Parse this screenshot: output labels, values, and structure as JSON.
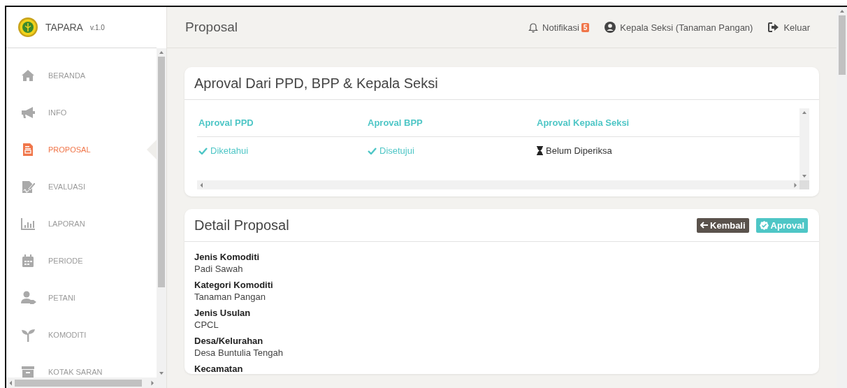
{
  "brand": {
    "name": "TAPARA",
    "version": "v.1.0"
  },
  "sidebar": {
    "items": [
      {
        "label": "BERANDA",
        "selected": false
      },
      {
        "label": "INFO",
        "selected": false
      },
      {
        "label": "PROPOSAL",
        "selected": true
      },
      {
        "label": "EVALUASI",
        "selected": false
      },
      {
        "label": "LAPORAN",
        "selected": false
      },
      {
        "label": "PERIODE",
        "selected": false
      },
      {
        "label": "PETANI",
        "selected": false
      },
      {
        "label": "KOMODITI",
        "selected": false
      },
      {
        "label": "KOTAK SARAN",
        "selected": false
      }
    ]
  },
  "topbar": {
    "title": "Proposal",
    "notification": {
      "label": "Notifikasi",
      "count": "5"
    },
    "user": "Kepala Seksi (Tanaman Pangan)",
    "logout": "Keluar"
  },
  "approval_card": {
    "title": "Aproval Dari PPD, BPP & Kepala Seksi",
    "table": {
      "columns": [
        "Aproval PPD",
        "Aproval BPP",
        "Aproval Kepala Seksi"
      ],
      "rows": [
        [
          {
            "text": "Diketahui",
            "done": true
          },
          {
            "text": "Disetujui",
            "done": true
          },
          {
            "text": "Belum Diperiksa",
            "done": false
          }
        ]
      ]
    }
  },
  "detail_card": {
    "title": "Detail Proposal",
    "buttons": [
      {
        "label": "Kembali",
        "kind": "back"
      },
      {
        "label": "Aproval",
        "kind": "approve"
      }
    ],
    "fields": [
      {
        "label": "Jenis Komoditi",
        "value": "Padi Sawah"
      },
      {
        "label": "Kategori Komoditi",
        "value": "Tanaman Pangan"
      },
      {
        "label": "Jenis Usulan",
        "value": "CPCL"
      },
      {
        "label": "Desa/Kelurahan",
        "value": "Desa Buntulia Tengah"
      },
      {
        "label": "Kecamatan"
      }
    ]
  }
}
